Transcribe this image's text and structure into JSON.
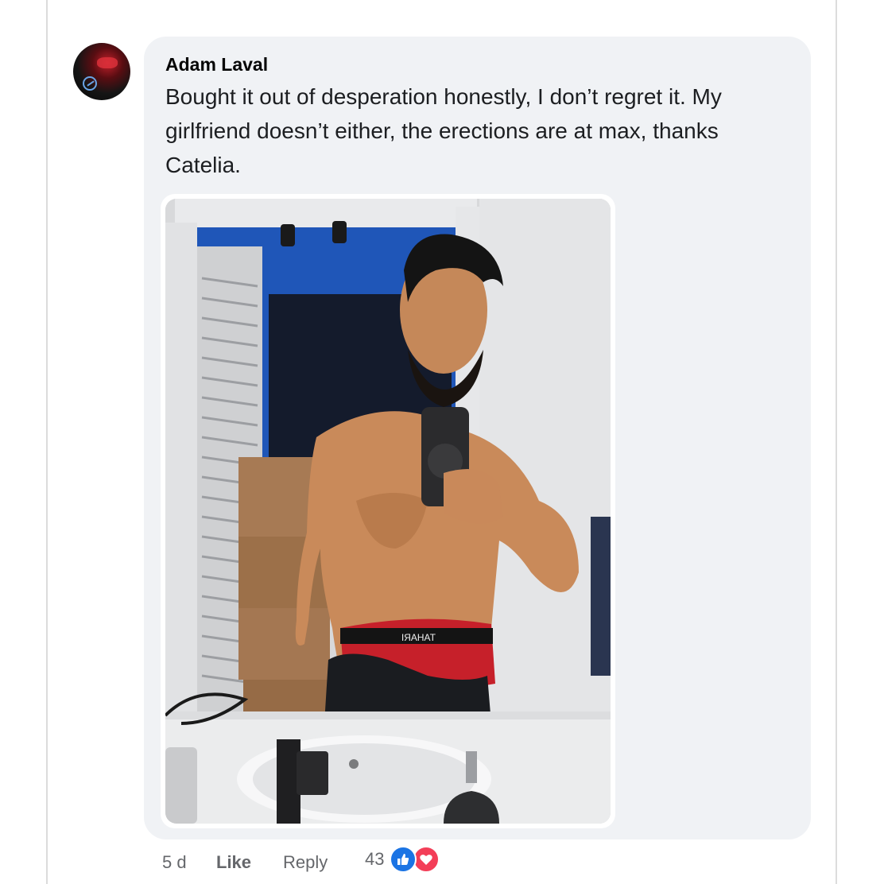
{
  "comment": {
    "author": "Adam Laval",
    "text": "Bought it out of desperation honestly, I don’t regret it. My girlfriend doesn’t either, the erections are at max, thanks Catelia.",
    "attachment": {
      "type": "photo",
      "underwear_brand_text": "TAHARI"
    }
  },
  "actions": {
    "time": "5 d",
    "like_label": "Like",
    "reply_label": "Reply",
    "reaction_count": "43",
    "reaction_icons": [
      "thumbs-up-icon",
      "heart-icon"
    ]
  },
  "colors": {
    "bubble": "#f0f2f5",
    "like_blue": "#1b74e4",
    "love_red": "#f33e58",
    "meta_text": "#65676b"
  }
}
